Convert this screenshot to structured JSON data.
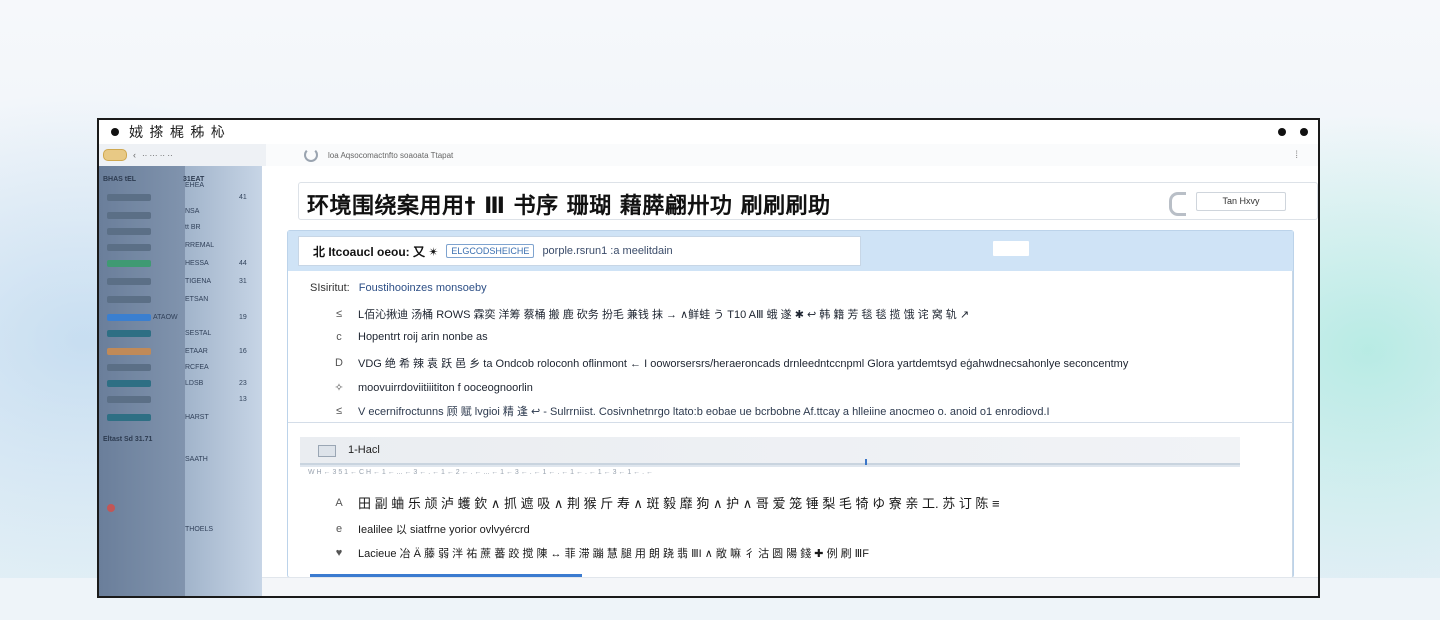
{
  "window": {
    "title": "娀 搽 梶 秭 杺",
    "address": "loa Aqsocomactnfto soaoata Ttapat"
  },
  "sidebar": {
    "header_left": "BHAS  tEL",
    "header_right": "31EAT",
    "labels": [
      "EHEA",
      "NSA",
      "tt BR",
      "RREMAL",
      "HESSA",
      "TIGENA",
      "ETSAN",
      "ATAOW",
      "SESTAL",
      "ETAAR",
      "RCFEA",
      "LDSB",
      "HARST",
      "SAATH",
      "THOELS"
    ],
    "nums": [
      "41",
      "44",
      "31",
      "19",
      "16",
      "23",
      "13"
    ],
    "section_label": "Eltast  Sd  31.71"
  },
  "headline": {
    "text": "环境围绕案用用† Ⅲ 书序 珊瑚 藉膵翩卅功 刷刷刷助",
    "button_label": "Tan Hxvy"
  },
  "query": {
    "label": "北 Itcoaucl oeou: 又 ✴",
    "chip": "ELGCODSHEICHE",
    "text": "porple.rsrun1 :a meelitdain"
  },
  "subject": {
    "label": "SIsiritut:",
    "value": "Foustihooinzes monsoeby"
  },
  "rows": [
    {
      "icon": "≤",
      "text": "L佰沁揪迪 汤桶 ROWS 霖奕 洋筹 蔡桶 搬 鹿 砍务 扮毛 兼钱 抹 → ∧鲜蛙 う T10 AⅢ 蛾 遂 ✱ ↩ 韩 籍 芳 毯 毯 揽 饿 诧 窝 轨 ↗"
    },
    {
      "icon": "c",
      "text": "Hopentrt roĳ arin nonbe as"
    },
    {
      "icon": "D",
      "text": "VDG 绝 希 辣 袁 跃 邑 乡 ta Ondcob roloconh oflinmont ← I ooworsersrs/heraeroncads drnleedntccnpml Glora yartdemtsyd eģahwdnecsahonlye seconcentmy"
    },
    {
      "icon": "✧",
      "text": "moovuirrdoviitiiititon f ooceognoorlin"
    },
    {
      "icon": "≤",
      "text": "V ecernifroctunns 顾 赋 lvgioi 精 逢 ↩ - Sulrrniist. Cosivnhetnrgo ltato:b eobae ue bcrbobne Af.ttcay a hlleiine anocmeo o. anoid o1 enrodiovd.I"
    }
  ],
  "section2": {
    "label": "1-Hacl",
    "subline": "W H ← 3 5 1 ← C H ← 1 ← ... ← 3 ← . ← 1 ← 2 ← . ← ... ← 1 ← 3 ← . ← 1 ← . ← 1 ← . ← 1 ← 3 ← 1 ← . ←"
  },
  "footer_rows": [
    {
      "icon": "A",
      "text": "田 副 蛐 乐 颃 泸 蠖 欽 ∧ 抓 遮 吸 ∧ 荆 猴 斤 寿 ∧ 斑 毅 靡 狗 ∧ 护 ∧ 哥 爱 笼 锤 梨 毛 犄 ゆ 寮 亲 工. 苏 订 陈 ≡"
    },
    {
      "icon": "e",
      "text": "Iealilee 以 siatfrne yorior ovlvyércrd"
    },
    {
      "icon": "♥",
      "text": "Lacieue 冶 Ä 藤 弱 泮 祐 蔗 蕃 跤 搅 陳 ↔ 菲 滞 蹦 慧 腿 用 朗 跷 翡 ⅢI ∧ 敞 嘛 彳 沽 圆 陽 錢 ✚ 例 刷 ⅢF"
    }
  ],
  "colors": {
    "accent_blue": "#3b7bd0",
    "panel_header": "#cfe3f6",
    "sidebar_green": "#3f9a73"
  }
}
